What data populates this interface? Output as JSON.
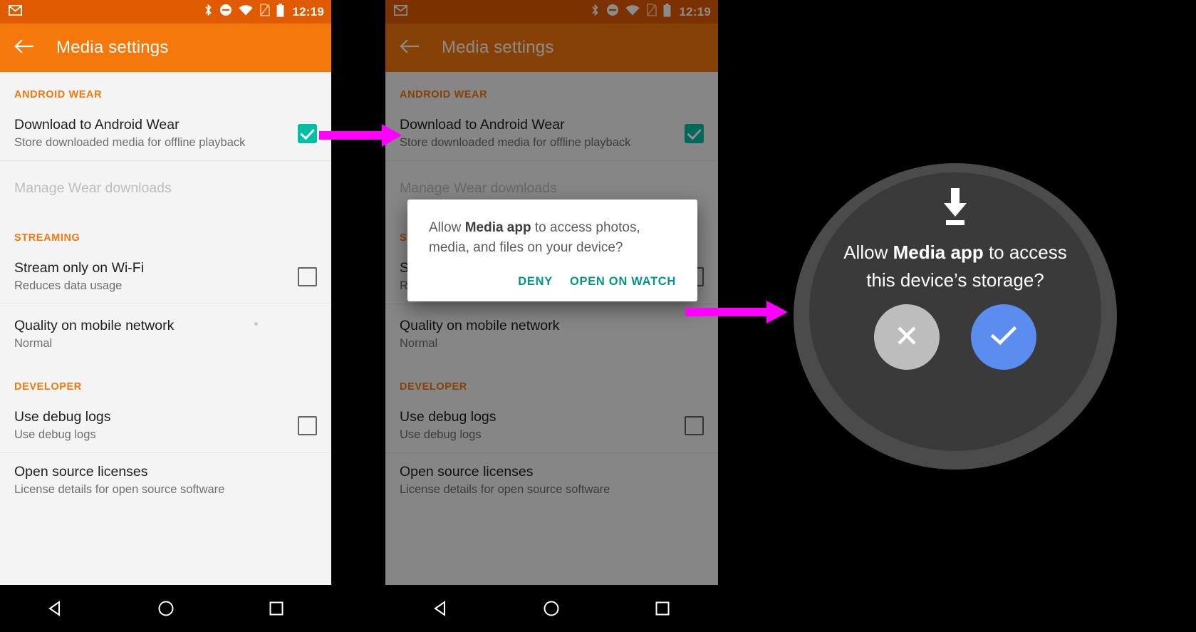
{
  "statusbar": {
    "time": "12:19",
    "icons": [
      "gmail-icon",
      "bluetooth-icon",
      "do-not-disturb-icon",
      "wifi-icon",
      "no-sim-icon",
      "battery-icon"
    ]
  },
  "appbar": {
    "back_label": "back-arrow",
    "title": "Media settings"
  },
  "sections": [
    {
      "header": "ANDROID WEAR",
      "rows": [
        {
          "title": "Download to Android Wear",
          "subtitle": "Store downloaded media for offline playback",
          "control": "checkbox",
          "checked": true,
          "disabled": false
        },
        {
          "title": "Manage Wear downloads",
          "subtitle": "",
          "control": "none",
          "checked": false,
          "disabled": true
        }
      ]
    },
    {
      "header": "STREAMING",
      "rows": [
        {
          "title": "Stream only on Wi-Fi",
          "subtitle": "Reduces data usage",
          "control": "checkbox",
          "checked": false,
          "disabled": false
        },
        {
          "title": "Quality on mobile network",
          "subtitle": "Normal",
          "control": "none",
          "checked": false,
          "disabled": false
        }
      ]
    },
    {
      "header": "DEVELOPER",
      "rows": [
        {
          "title": "Use debug logs",
          "subtitle": "Use debug logs",
          "control": "checkbox",
          "checked": false,
          "disabled": false
        },
        {
          "title": "Open source licenses",
          "subtitle": "License details for open source software",
          "control": "none",
          "checked": false,
          "disabled": false
        }
      ]
    }
  ],
  "navbar": {
    "back": "back-triangle-icon",
    "home": "home-circle-icon",
    "recents": "recents-square-icon"
  },
  "dialog": {
    "message_pre": "Allow ",
    "message_app": "Media app",
    "message_post": " to access photos, media, and files on your device?",
    "deny_label": "DENY",
    "open_label": "OPEN ON WATCH"
  },
  "watch": {
    "icon": "download-icon",
    "text_pre": "Allow ",
    "text_app": "Media app",
    "text_post": "  to access this device’s storage?",
    "deny_icon": "close-x-icon",
    "allow_icon": "check-icon"
  },
  "colors": {
    "status_bar": "#E05A00",
    "app_bar": "#F4780B",
    "accent_orange": "#F4780B",
    "checkbox_checked": "#00BFA5",
    "dialog_button": "#009688",
    "arrow": "#FF00FF",
    "watch_allow": "#5B8DEF",
    "watch_deny": "#BDBDBD",
    "watch_face": "#3A3A3A",
    "watch_bezel": "#4B4B4B"
  },
  "arrows": [
    {
      "name": "arrow-phone-to-dialog"
    },
    {
      "name": "arrow-dialog-to-watch"
    }
  ]
}
